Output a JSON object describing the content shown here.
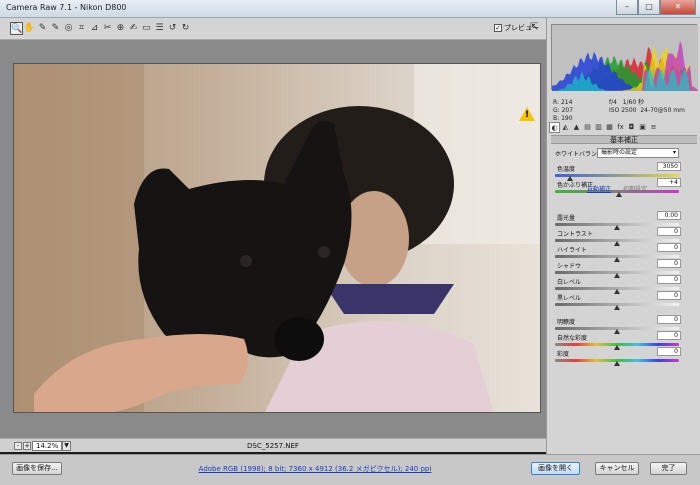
{
  "window": {
    "title": "Camera Raw 7.1  -  Nikon D800",
    "min": "–",
    "max": "□",
    "close": "✕"
  },
  "toolbar": {
    "tools": [
      {
        "name": "zoom-tool-icon",
        "glyph": "🔍"
      },
      {
        "name": "hand-tool-icon",
        "glyph": "✋"
      },
      {
        "name": "white-balance-tool-icon",
        "glyph": "✎"
      },
      {
        "name": "color-sampler-tool-icon",
        "glyph": "✎"
      },
      {
        "name": "target-adjustment-tool-icon",
        "glyph": "◎"
      },
      {
        "name": "crop-tool-icon",
        "glyph": "⌗"
      },
      {
        "name": "straighten-tool-icon",
        "glyph": "⊿"
      },
      {
        "name": "spot-removal-tool-icon",
        "glyph": "✂"
      },
      {
        "name": "red-eye-tool-icon",
        "glyph": "⊕"
      },
      {
        "name": "adjustment-brush-icon",
        "glyph": "✍"
      },
      {
        "name": "graduated-filter-icon",
        "glyph": "▭"
      },
      {
        "name": "preferences-icon",
        "glyph": "☰"
      },
      {
        "name": "rotate-ccw-icon",
        "glyph": "↺"
      },
      {
        "name": "rotate-cw-icon",
        "glyph": "↻"
      }
    ],
    "preview_check": "✓",
    "preview_label": "プレビュー",
    "fullscreen_glyph": "⇱"
  },
  "canvas": {
    "warning_glyph": "!"
  },
  "status": {
    "zoom_out": "-",
    "zoom_in": "+",
    "zoom_value": "14.2%",
    "zoom_arrow": "▼",
    "filename": "DSC_5257.NEF"
  },
  "histogram": {
    "colors": [
      "#d8242f",
      "#1f9b2d",
      "#233fd6",
      "#e7d318",
      "#c02ac1",
      "#19c6c8"
    ]
  },
  "info": {
    "r_label": "R:",
    "r": "214",
    "g_label": "G:",
    "g": "207",
    "b_label": "B:",
    "b": "190",
    "aperture": "f/4",
    "shutter": "1/60 秒",
    "iso": "ISO 2500",
    "lens": "24-70@50 mm"
  },
  "panel_tabs": [
    "◐",
    "◭",
    "▲",
    "▤",
    "▥",
    "▦",
    "fx",
    "◘",
    "▣",
    "≡"
  ],
  "basic": {
    "title": "基本補正",
    "wb_label": "ホワイトバランス：",
    "wb_value": "撮影時の設定",
    "wb_arrow": "▾",
    "temp_label": "色温度",
    "temp_value": "3050",
    "tint_label": "色かぶり補正",
    "tint_value": "+4",
    "auto": "自動補正",
    "default": "初期設定",
    "sliders": [
      {
        "label": "露光量",
        "value": "0.00",
        "pos": 0.5
      },
      {
        "label": "コントラスト",
        "value": "0",
        "pos": 0.5
      },
      {
        "label": "ハイライト",
        "value": "0",
        "pos": 0.5
      },
      {
        "label": "シャドウ",
        "value": "0",
        "pos": 0.5
      },
      {
        "label": "白レベル",
        "value": "0",
        "pos": 0.5
      },
      {
        "label": "黒レベル",
        "value": "0",
        "pos": 0.5
      },
      {
        "label": "明瞭度",
        "value": "0",
        "pos": 0.5
      },
      {
        "label": "自然な彩度",
        "value": "0",
        "pos": 0.5
      },
      {
        "label": "彩度",
        "value": "0",
        "pos": 0.5
      }
    ],
    "temp_pos": 0.12,
    "tint_pos": 0.52
  },
  "bottom": {
    "save": "画像を保存...",
    "workflow_link": "Adobe RGB (1998); 8 bit; 7360 x 4912 (36.2 メガピクセル); 240 ppi",
    "open": "画像を開く",
    "cancel": "キャンセル",
    "done": "完了"
  }
}
